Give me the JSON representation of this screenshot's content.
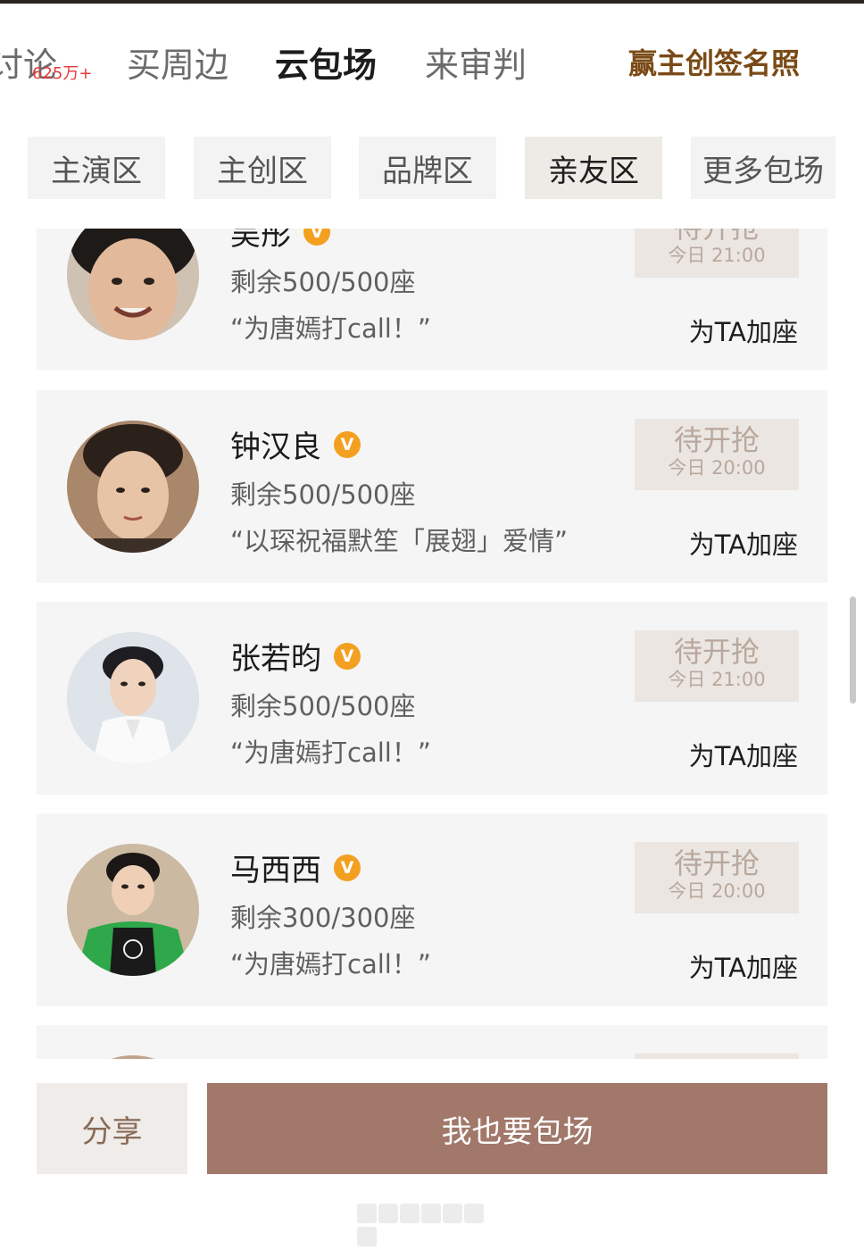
{
  "top_tabs": {
    "discuss_label": "讨论",
    "discuss_count": "625万+",
    "merch_label": "买周边",
    "screening_label": "云包场",
    "judge_label": "来审判",
    "promo_label": "赢主创签名照"
  },
  "chips": {
    "lead": "主演区",
    "creator": "主创区",
    "brand": "品牌区",
    "friends": "亲友区",
    "more": "更多包场"
  },
  "cards": [
    {
      "name": "吴彤",
      "seats": "剩余500/500座",
      "message": "“为唐嫣打call！”",
      "button": "待开抢",
      "time": "今日 21:00",
      "action": "为TA加座"
    },
    {
      "name": "钟汉良",
      "seats": "剩余500/500座",
      "message": "“以琛祝福默笙「展翅」爱情”",
      "button": "待开抢",
      "time": "今日 20:00",
      "action": "为TA加座"
    },
    {
      "name": "张若昀",
      "seats": "剩余500/500座",
      "message": "“为唐嫣打call！”",
      "button": "待开抢",
      "time": "今日 21:00",
      "action": "为TA加座"
    },
    {
      "name": "马西西",
      "seats": "剩余300/300座",
      "message": "“为唐嫣打call！”",
      "button": "待开抢",
      "time": "今日 20:00",
      "action": "为TA加座"
    }
  ],
  "bottom": {
    "share": "分享",
    "book": "我也要包场"
  },
  "colors": {
    "accent": "#a1786a",
    "promo": "#7a4a16",
    "verified": "#f3a020"
  }
}
